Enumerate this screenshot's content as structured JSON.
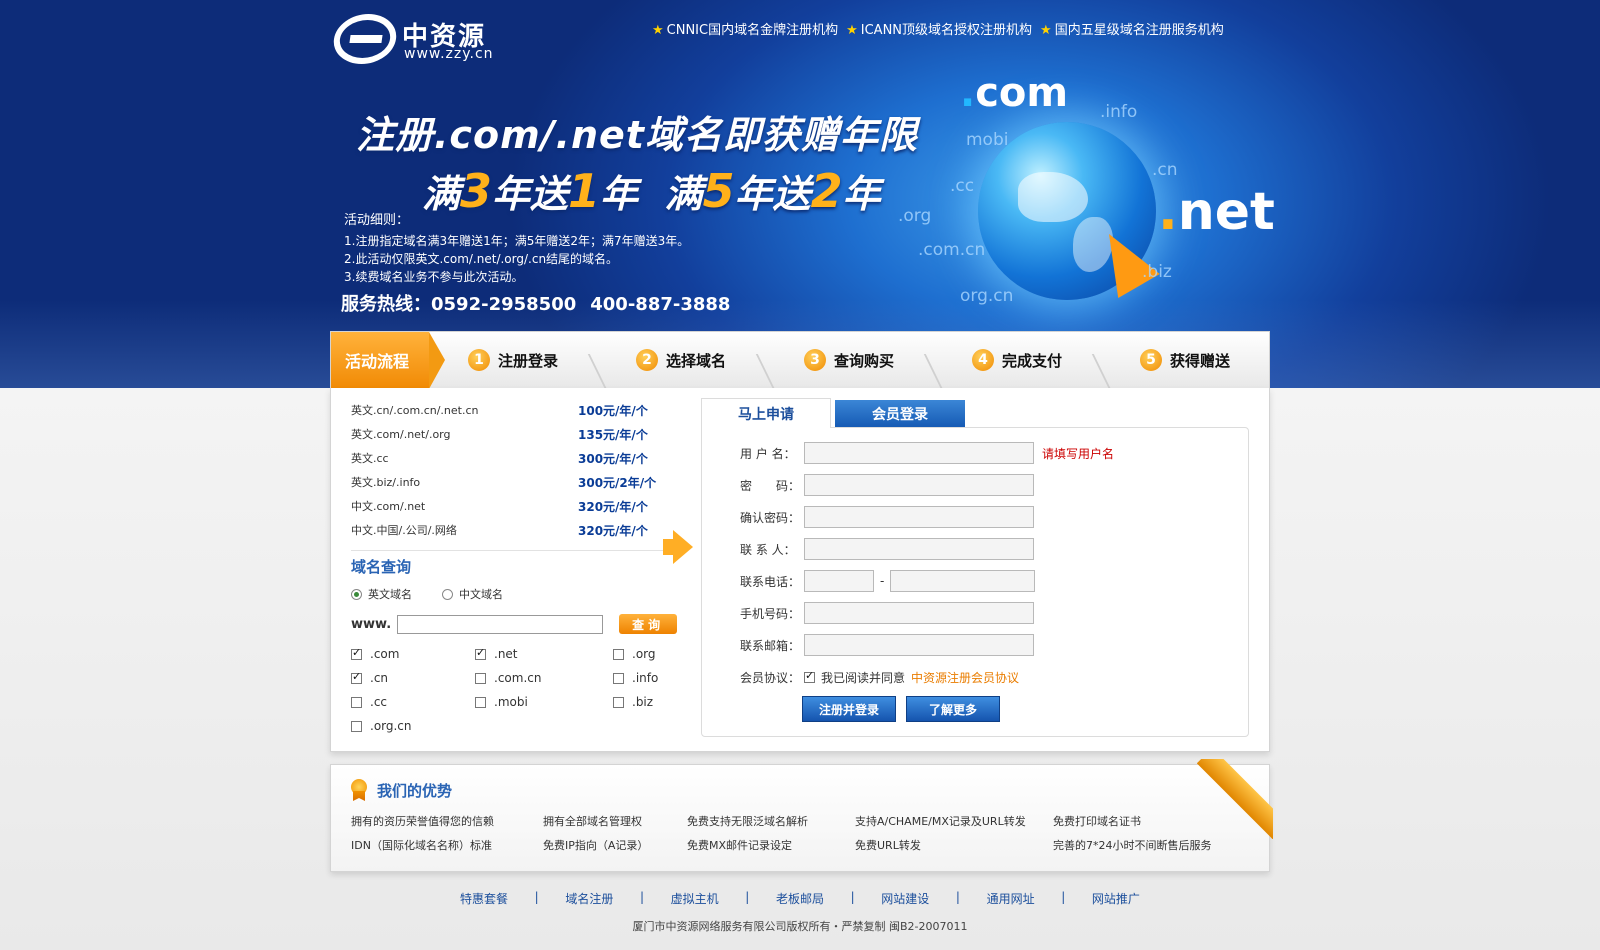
{
  "header": {
    "logo_cn": "中资源",
    "logo_url": "www.zzy.cn",
    "certs": [
      "CNNIC国内域名金牌注册机构",
      "ICANN顶级域名授权注册机构",
      "国内五星级域名注册服务机构"
    ]
  },
  "banner": {
    "headline": "注册.com/.net域名即获赠年限",
    "sub_prefix1": "满",
    "sub_n1": "3",
    "sub_mid1": "年送",
    "sub_n2": "1",
    "sub_suffix1": "年",
    "sub_prefix2": "满",
    "sub_n3": "5",
    "sub_mid2": "年送",
    "sub_n4": "2",
    "sub_suffix2": "年",
    "rules_title": "活动细则：",
    "rules": [
      "1.注册指定域名满3年赠送1年；满5年赠送2年；满7年赠送3年。",
      "2.此活动仅限英文.com/.net/.org/.cn结尾的域名。",
      "3.续费域名业务不参与此次活动。"
    ],
    "hotline_label": "服务热线：",
    "hotline_1": "0592-2958500",
    "hotline_2": "400-887-3888",
    "tld_com": "com",
    "tld_net": "net",
    "tld_small": [
      ".info",
      "mobi",
      ".cn",
      ".cc",
      ".org",
      ".com.cn",
      ".biz",
      "org.cn"
    ]
  },
  "steps": {
    "first": "活动流程",
    "items": [
      {
        "num": "1",
        "label": "注册登录"
      },
      {
        "num": "2",
        "label": "选择域名"
      },
      {
        "num": "3",
        "label": "查询购买"
      },
      {
        "num": "4",
        "label": "完成支付"
      },
      {
        "num": "5",
        "label": "获得赠送"
      }
    ]
  },
  "prices": [
    {
      "name": "英文.cn/.com.cn/.net.cn",
      "price": "100元/年/个"
    },
    {
      "name": "英文.com/.net/.org",
      "price": "135元/年/个"
    },
    {
      "name": "英文.cc",
      "price": "300元/年/个"
    },
    {
      "name": "英文.biz/.info",
      "price": "300元/2年/个"
    },
    {
      "name": "中文.com/.net",
      "price": "320元/年/个"
    },
    {
      "name": "中文.中国/.公司/.网络",
      "price": "320元/年/个"
    }
  ],
  "search": {
    "title": "域名查询",
    "radio_en": "英文域名",
    "radio_cn": "中文域名",
    "www_label": "www.",
    "button": "查询",
    "tlds": [
      {
        "label": ".com",
        "checked": true
      },
      {
        "label": ".net",
        "checked": true
      },
      {
        "label": ".org",
        "checked": false
      },
      {
        "label": ".cn",
        "checked": true
      },
      {
        "label": ".com.cn",
        "checked": false
      },
      {
        "label": ".info",
        "checked": false
      },
      {
        "label": ".cc",
        "checked": false
      },
      {
        "label": ".mobi",
        "checked": false
      },
      {
        "label": ".biz",
        "checked": false
      },
      {
        "label": ".org.cn",
        "checked": false
      }
    ]
  },
  "form": {
    "tab_apply": "马上申请",
    "tab_login": "会员登录",
    "username_label": "用 户 名：",
    "username_hint": "请填写用户名",
    "password_label": "密　　码：",
    "confirm_label": "确认密码：",
    "contact_label": "联 系 人：",
    "phone_label": "联系电话：",
    "phone_dash": "-",
    "mobile_label": "手机号码：",
    "email_label": "联系邮箱：",
    "agreement_label": "会员协议：",
    "agreement_text": "我已阅读并同意",
    "agreement_link": "中资源注册会员协议",
    "register_button": "注册并登录",
    "more_button": "了解更多"
  },
  "advantages": {
    "title": "我们的优势",
    "items": [
      "拥有的资历荣誉值得您的信赖",
      "拥有全部域名管理权",
      "免费支持无限泛域名解析",
      "支持A/CHAME/MX记录及URL转发",
      "免费打印域名证书",
      "IDN（国际化域名名称）标准",
      "免费IP指向（A记录）",
      "免费MX邮件记录设定",
      "免费URL转发",
      "完善的7*24小时不间断售后服务"
    ]
  },
  "footer": {
    "links": [
      "特惠套餐",
      "域名注册",
      "虚拟主机",
      "老板邮局",
      "网站建设",
      "通用网址",
      "网站推广"
    ],
    "separator": "|",
    "copyright": "厦门市中资源网络服务有限公司版权所有・严禁复制 闽B2-2007011"
  }
}
